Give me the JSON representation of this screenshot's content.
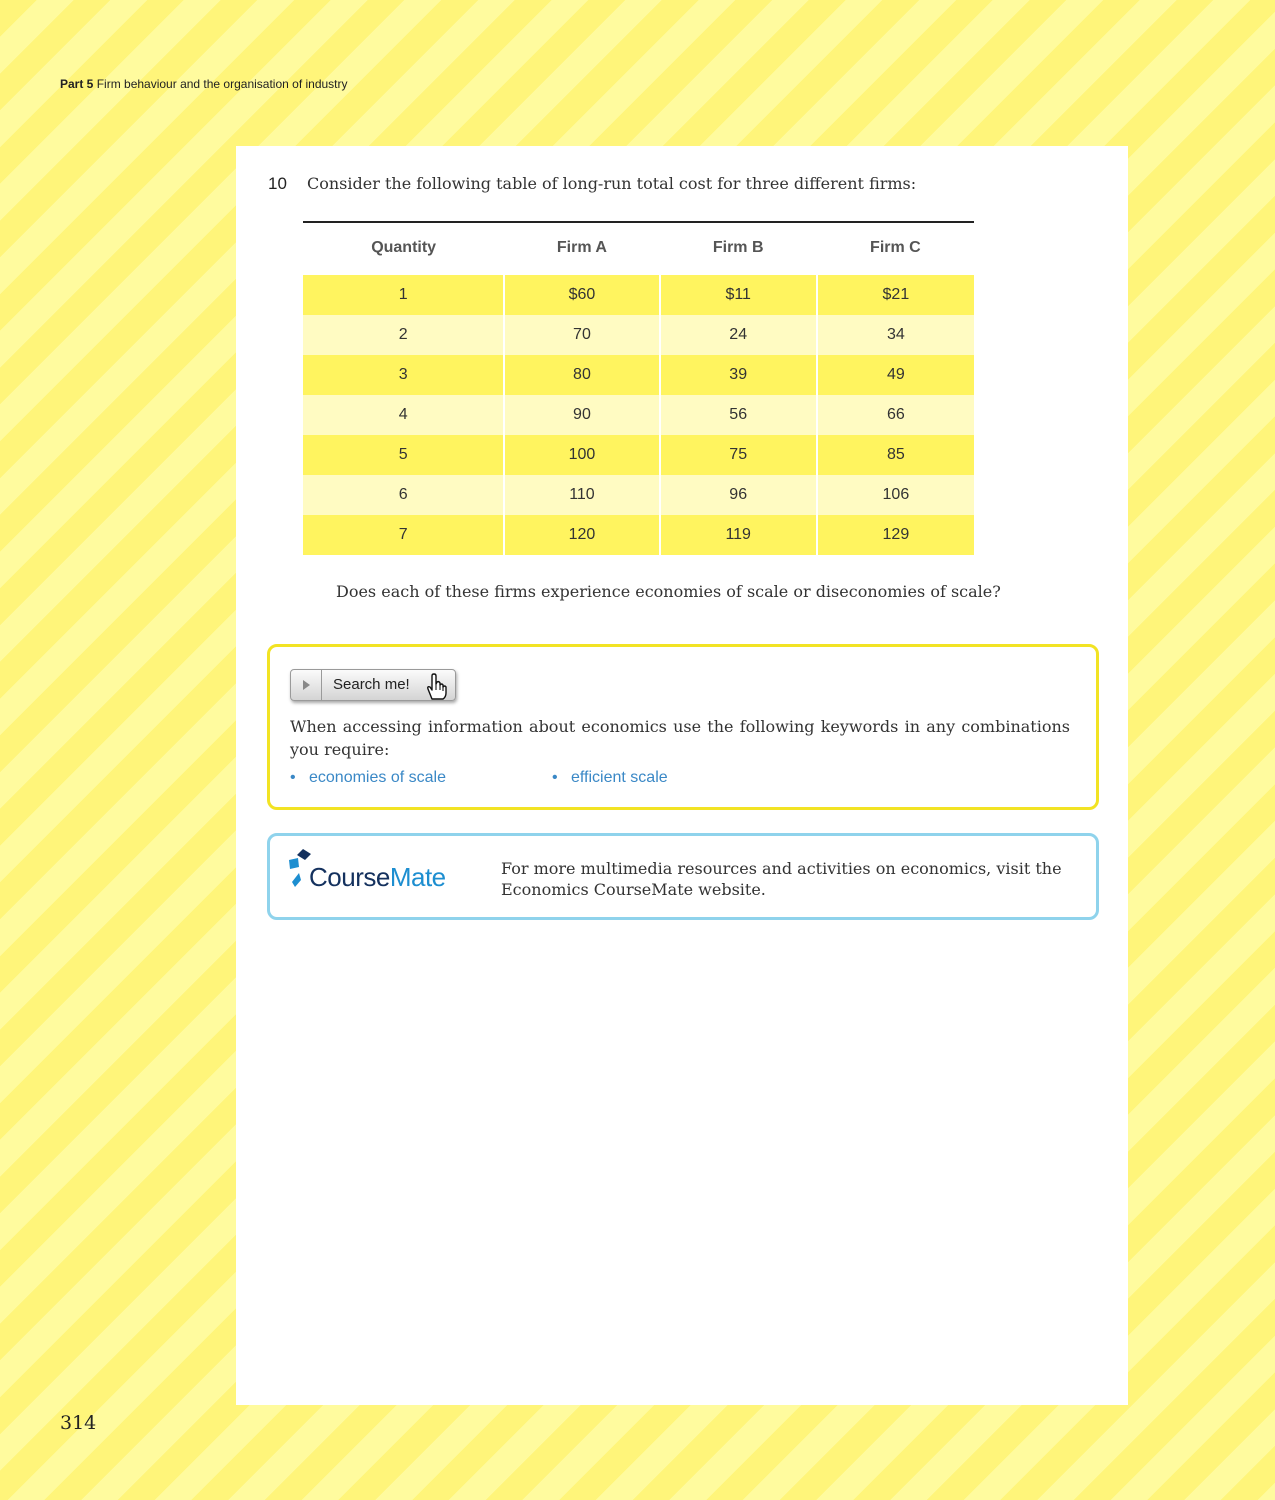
{
  "running_head": {
    "part": "Part 5",
    "title": "Firm behaviour and the organisation of industry"
  },
  "question": {
    "number": "10",
    "text": "Consider the following table of long-run total cost for three different firms:",
    "follow_up": "Does each of these firms experience economies of scale or diseconomies of scale?"
  },
  "table": {
    "headers": [
      "Quantity",
      "Firm A",
      "Firm B",
      "Firm C"
    ],
    "rows": [
      [
        "1",
        "$60",
        "$11",
        "$21"
      ],
      [
        "2",
        "70",
        "24",
        "34"
      ],
      [
        "3",
        "80",
        "39",
        "49"
      ],
      [
        "4",
        "90",
        "56",
        "66"
      ],
      [
        "5",
        "100",
        "75",
        "85"
      ],
      [
        "6",
        "110",
        "96",
        "106"
      ],
      [
        "7",
        "120",
        "119",
        "129"
      ]
    ]
  },
  "search_box": {
    "button_label": "Search me!",
    "intro": "When accessing information about economics use the following keywords in any combinations you require:",
    "keywords": [
      "economies of scale",
      "efficient scale"
    ]
  },
  "coursemate": {
    "logo_part1": "Course",
    "logo_part2": "Mate",
    "text": "For more multimedia resources and activities on economics, visit the Economics CourseMate website."
  },
  "page_number": "314",
  "colors": {
    "stripe_dark": "#fff57a",
    "stripe_light": "#fffb9e",
    "row_dark": "#fff45f",
    "row_light": "#fffbc2",
    "search_border": "#f2e323",
    "coursemate_border": "#8fd3ec",
    "keyword_blue": "#3a88c6",
    "logo_navy": "#14315e",
    "logo_blue": "#1d8ed0"
  }
}
